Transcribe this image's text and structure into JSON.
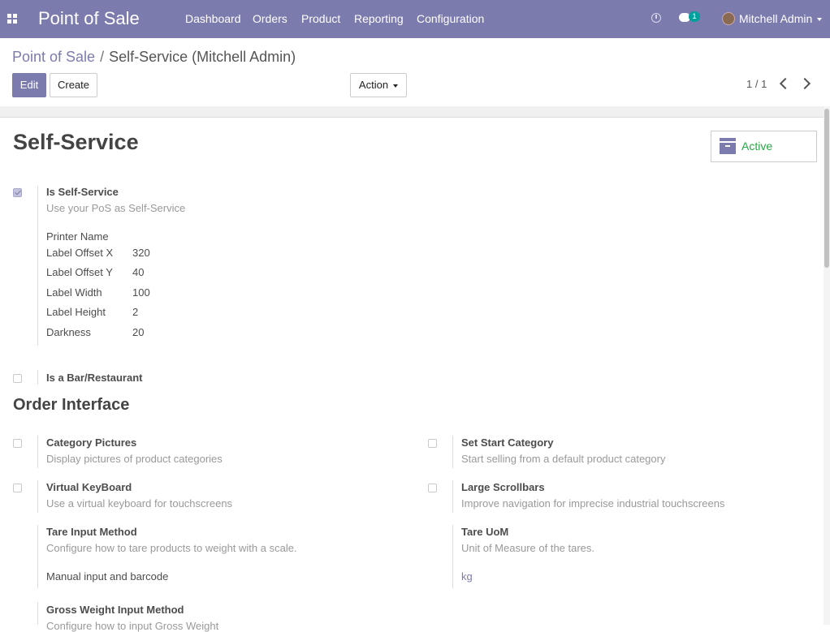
{
  "navbar": {
    "app_title": "Point of Sale",
    "menu": [
      "Dashboard",
      "Orders",
      "Product",
      "Reporting",
      "Configuration"
    ],
    "chat_count": "1",
    "user": "Mitchell Admin",
    "bg_color": "#7c7bad"
  },
  "breadcrumb": {
    "parent": "Point of Sale",
    "separator": "/",
    "current": "Self-Service (Mitchell Admin)"
  },
  "buttons": {
    "edit": "Edit",
    "create": "Create",
    "action": "Action"
  },
  "pager": {
    "text": "1 / 1"
  },
  "record": {
    "title": "Self-Service",
    "active_label": "Active"
  },
  "self_service": {
    "label": "Is Self-Service",
    "help": "Use your PoS as Self-Service",
    "checked": true,
    "fields": [
      {
        "label": "Printer Name",
        "value": ""
      },
      {
        "label": "Label Offset X",
        "value": "320"
      },
      {
        "label": "Label Offset Y",
        "value": "40"
      },
      {
        "label": "Label Width",
        "value": "100"
      },
      {
        "label": "Label Height",
        "value": "2"
      },
      {
        "label": "Darkness",
        "value": "20"
      }
    ]
  },
  "bar_restaurant": {
    "label": "Is a Bar/Restaurant",
    "checked": false
  },
  "order_interface": {
    "heading": "Order Interface",
    "category_pictures": {
      "label": "Category Pictures",
      "help": "Display pictures of product categories"
    },
    "set_start_category": {
      "label": "Set Start Category",
      "help": "Start selling from a default product category"
    },
    "virtual_keyboard": {
      "label": "Virtual KeyBoard",
      "help": "Use a virtual keyboard for touchscreens"
    },
    "large_scrollbars": {
      "label": "Large Scrollbars",
      "help": "Improve navigation for imprecise industrial touchscreens"
    },
    "tare_input": {
      "label": "Tare Input Method",
      "help": "Configure how to tare products to weight with a scale.",
      "value": "Manual input and barcode"
    },
    "tare_uom": {
      "label": "Tare UoM",
      "help": "Unit of Measure of the tares.",
      "value": "kg"
    },
    "gross_weight": {
      "label": "Gross Weight Input Method",
      "help": "Configure how to input Gross Weight"
    }
  }
}
